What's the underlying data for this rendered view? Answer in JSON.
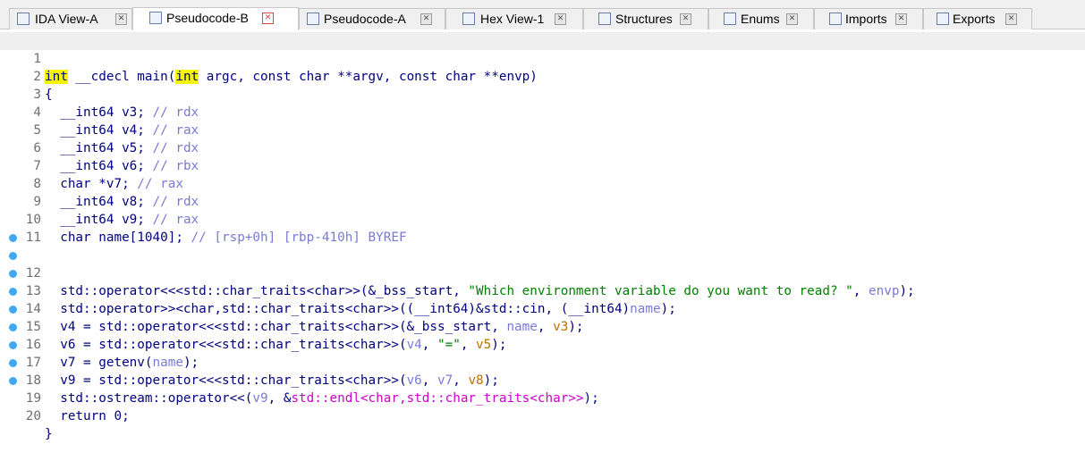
{
  "tabs": [
    {
      "label": "IDA View-A",
      "icon": "disassembly-view-icon",
      "active": false
    },
    {
      "label": "Pseudocode-B",
      "icon": "pseudocode-icon",
      "active": true
    },
    {
      "label": "Pseudocode-A",
      "icon": "pseudocode-icon",
      "active": false
    },
    {
      "label": "Hex View-1",
      "icon": "hex-view-icon",
      "active": false
    },
    {
      "label": "Structures",
      "icon": "structures-icon",
      "active": false
    },
    {
      "label": "Enums",
      "icon": "enums-icon",
      "active": false
    },
    {
      "label": "Imports",
      "icon": "imports-icon",
      "active": false
    },
    {
      "label": "Exports",
      "icon": "exports-icon",
      "active": false
    }
  ],
  "close_glyph": "✕",
  "code": {
    "lines": [
      {
        "n": "1",
        "bp": false
      },
      {
        "n": "2",
        "bp": false
      },
      {
        "n": "3",
        "bp": false
      },
      {
        "n": "4",
        "bp": false
      },
      {
        "n": "5",
        "bp": false
      },
      {
        "n": "6",
        "bp": false
      },
      {
        "n": "7",
        "bp": false
      },
      {
        "n": "8",
        "bp": false
      },
      {
        "n": "9",
        "bp": false
      },
      {
        "n": "10",
        "bp": false
      },
      {
        "n": "11",
        "bp": false
      },
      {
        "n": "12",
        "bp": true
      },
      {
        "n": "13",
        "bp": true
      },
      {
        "n": "14",
        "bp": true
      },
      {
        "n": "15",
        "bp": true
      },
      {
        "n": "16",
        "bp": true
      },
      {
        "n": "17",
        "bp": true
      },
      {
        "n": "18",
        "bp": true
      },
      {
        "n": "19",
        "bp": true
      },
      {
        "n": "20",
        "bp": true
      }
    ],
    "tokens": {
      "l1": [
        "int",
        " __cdecl main(",
        "int",
        " argc, const char **argv, const char **envp)"
      ],
      "l2": "{",
      "l3": [
        "  __int64 v3; ",
        "// rdx"
      ],
      "l4": [
        "  __int64 v4; ",
        "// rax"
      ],
      "l5": [
        "  __int64 v5; ",
        "// rdx"
      ],
      "l6": [
        "  __int64 v6; ",
        "// rbx"
      ],
      "l7": [
        "  char *v7; ",
        "// rax"
      ],
      "l8": [
        "  __int64 v8; ",
        "// rdx"
      ],
      "l9": [
        "  __int64 v9; ",
        "// rax"
      ],
      "l10": [
        "  char name[1040]; ",
        "// [rsp+0h] [rbp-410h] BYREF"
      ],
      "l12": [
        "  std::operator<<<std::char_traits<char>>(&_bss_start, ",
        "\"Which environment variable do you want to read? \"",
        ", ",
        "envp",
        ");"
      ],
      "l13": [
        "  std::operator>><char,std::char_traits<char>>((__int64)&std::cin, (__int64)",
        "name",
        ");"
      ],
      "l14": [
        "  v4 = std::operator<<<std::char_traits<char>>(&_bss_start, ",
        "name",
        ", ",
        "v3",
        ");"
      ],
      "l15": [
        "  v6 = std::operator<<<std::char_traits<char>>(",
        "v4",
        ", ",
        "\"=\"",
        ", ",
        "v5",
        ");"
      ],
      "l16": [
        "  v7 = getenv(",
        "name",
        ");"
      ],
      "l17": [
        "  v9 = std::operator<<<std::char_traits<char>>(",
        "v6",
        ", ",
        "v7",
        ", ",
        "v8",
        ");"
      ],
      "l18": [
        "  std::ostream::operator<<(",
        "v9",
        ", &",
        "std::endl<char,std::char_traits<char>>",
        ");"
      ],
      "l19": "  return 0;",
      "l20": "}"
    }
  }
}
